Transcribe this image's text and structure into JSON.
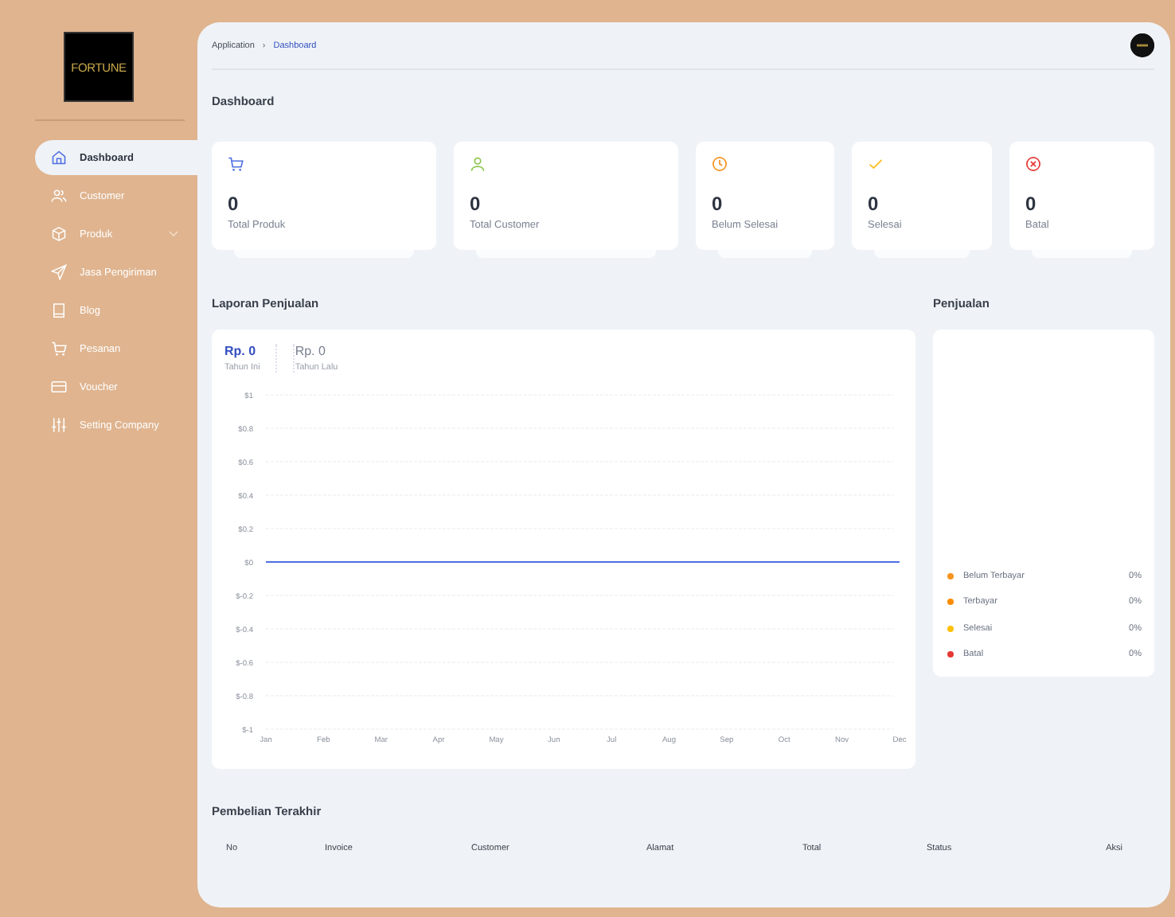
{
  "sidebar": {
    "logo": {
      "text": "FORTUNE"
    },
    "items": [
      {
        "label": "Dashboard",
        "kind": "home",
        "selected": true,
        "has_submenu": false
      },
      {
        "label": "Customer",
        "kind": "users",
        "selected": false,
        "has_submenu": false
      },
      {
        "label": "Produk",
        "kind": "box",
        "selected": false,
        "has_submenu": true
      },
      {
        "label": "Jasa Pengiriman",
        "kind": "send",
        "selected": false,
        "has_submenu": false
      },
      {
        "label": "Blog",
        "kind": "book",
        "selected": false,
        "has_submenu": false
      },
      {
        "label": "Pesanan",
        "kind": "cart",
        "selected": false,
        "has_submenu": false
      },
      {
        "label": "Voucher",
        "kind": "card",
        "selected": false,
        "has_submenu": false
      },
      {
        "label": "Setting Company",
        "kind": "sliders",
        "selected": false,
        "has_submenu": false
      }
    ]
  },
  "breadcrumb": {
    "items": [
      "Application",
      "Dashboard"
    ],
    "separator": "›"
  },
  "page_title": "Dashboard",
  "stats": [
    {
      "value": "0",
      "label": "Total Produk",
      "kind": "cart",
      "color": "#4f6fe0"
    },
    {
      "value": "0",
      "label": "Total Customer",
      "kind": "user",
      "color": "#8bc34a"
    },
    {
      "value": "0",
      "label": "Belum Selesai",
      "kind": "clock",
      "color": "#f7931e"
    },
    {
      "value": "0",
      "label": "Selesai",
      "kind": "check",
      "color": "#fbc02d"
    },
    {
      "value": "0",
      "label": "Batal",
      "kind": "xcircle",
      "color": "#e53935"
    }
  ],
  "sales_report": {
    "title": "Laporan Penjualan",
    "summary": [
      {
        "amount": "Rp. 0",
        "caption": "Tahun Ini",
        "selected": true
      },
      {
        "amount": "Rp. 0",
        "caption": "Tahun Lalu",
        "selected": false
      }
    ],
    "chart_data": {
      "type": "line",
      "grid": true,
      "categories": [
        "Jan",
        "Feb",
        "Mar",
        "Apr",
        "May",
        "Jun",
        "Jul",
        "Aug",
        "Sep",
        "Oct",
        "Nov",
        "Dec"
      ],
      "series": [
        {
          "color": "#4f6fe0",
          "values": [
            0,
            0,
            0,
            0,
            0,
            0,
            0,
            0,
            0,
            0,
            0,
            0
          ]
        }
      ],
      "ylim": [
        -1,
        1
      ],
      "yticks": [
        {
          "value": 1,
          "label": "$1"
        },
        {
          "value": 0.8,
          "label": "$0.8"
        },
        {
          "value": 0.6,
          "label": "$0.6"
        },
        {
          "value": 0.4,
          "label": "$0.4"
        },
        {
          "value": 0.2,
          "label": "$0.2"
        },
        {
          "value": 0,
          "label": "$0"
        },
        {
          "value": -0.2,
          "label": "$-0.2"
        },
        {
          "value": -0.4,
          "label": "$-0.4"
        },
        {
          "value": -0.6,
          "label": "$-0.6"
        },
        {
          "value": -0.8,
          "label": "$-0.8"
        },
        {
          "value": -1,
          "label": "$-1"
        }
      ]
    }
  },
  "sales": {
    "title": "Penjualan",
    "legend": [
      {
        "label": "Belum Terbayar",
        "value": "0%",
        "color": "#f7931e"
      },
      {
        "label": "Terbayar",
        "value": "0%",
        "color": "#fb8c00"
      },
      {
        "label": "Selesai",
        "value": "0%",
        "color": "#ffc107"
      },
      {
        "label": "Batal",
        "value": "0%",
        "color": "#e53935"
      }
    ]
  },
  "recent_purchases": {
    "title": "Pembelian Terakhir",
    "columns": [
      "No",
      "Invoice",
      "Customer",
      "Alamat",
      "Total",
      "Status",
      "Aksi"
    ]
  }
}
